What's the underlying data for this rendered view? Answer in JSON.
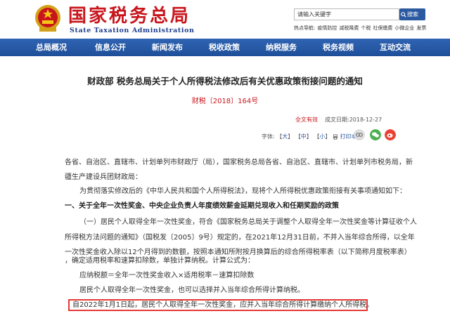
{
  "header": {
    "logo_cn": "国家税务总局",
    "logo_en": "State Taxation Administration",
    "search_placeholder": "请输入关键字",
    "search_button": "搜索",
    "hot_items": [
      "热点导航:",
      "疫情防控",
      "减税降费",
      "个税",
      "社保缴费",
      "小微企业",
      "发票"
    ]
  },
  "nav": {
    "items": [
      "总局概况",
      "信息公开",
      "新闻发布",
      "税收政策",
      "纳税服务",
      "税务视频",
      "互动交流"
    ]
  },
  "article": {
    "title": "财政部 税务总局关于个人所得税法修改后有关优惠政策衔接问题的通知",
    "doc_no": "财税〔2018〕164号",
    "validity": "全文有效",
    "date": "成文日期:2018-12-27",
    "font_label": "字体:",
    "font_large": "大",
    "font_medium": "中",
    "font_small": "小",
    "print": "打印本页",
    "paragraphs": [
      "各省、自治区、直辖市、计划单列市财政厅（局），国家税务总局各省、自治区、直辖市、计划单列市税务局，新",
      "疆生产建设兵团财政局：",
      "为贯彻落实修改后的《中华人民共和国个人所得税法》，现将个人所得税优惠政策衔接有关事项通知如下：",
      "一、关于全年一次性奖金、中央企业负责人年度绩效薪金延期兑现收入和任期奖励的政策",
      "（一）居民个人取得全年一次性奖金，符合《国家税务总局关于调整个人取得全年一次性奖金等计算征收个人",
      "所得税方法问题的通知》（国税发〔2005〕9号）规定的，在2021年12月31日前，不并入当年综合所得，以全年",
      "一次性奖金收入除以12个月得到的数额，按照本通知所附按月换算后的综合所得税率表（以下简称月度税率表）",
      "，确定适用税率和速算扣除数，单独计算纳税。计算公式为：",
      "应纳税额＝全年一次性奖金收入×适用税率－速算扣除数",
      "居民个人取得全年一次性奖金，也可以选择并入当年综合所得计算纳税。",
      "自2022年1月1日起，居民个人取得全年一次性奖金，应并入当年综合所得计算缴纳个人所得税。"
    ]
  },
  "colors": {
    "brand_red": "#c8161d",
    "nav_blue": "#2558a5",
    "highlight_red": "#e53935"
  }
}
